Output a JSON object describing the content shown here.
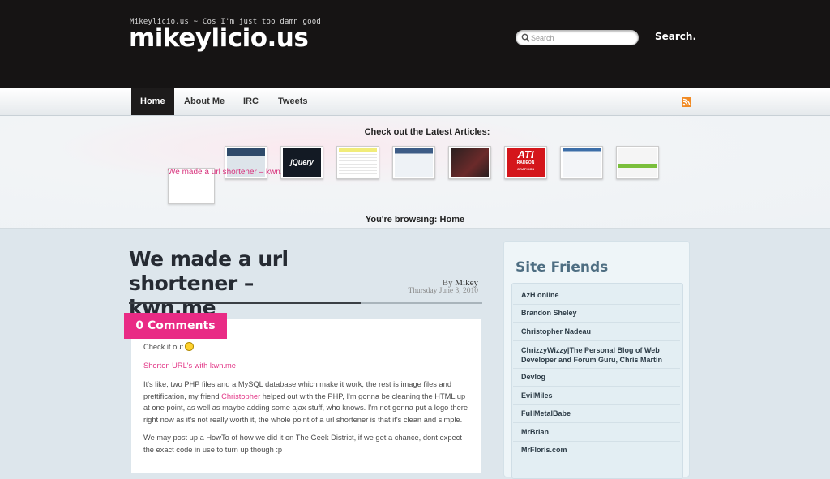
{
  "header": {
    "tagline": "Mikeylicio.us ~ Cos I'm just too damn good",
    "site_title": "mikeylicio.us",
    "search_placeholder": "Search",
    "search_button": "Search."
  },
  "nav": {
    "items": [
      {
        "label": "Home",
        "active": true
      },
      {
        "label": "About Me"
      },
      {
        "label": "IRC"
      },
      {
        "label": "Tweets"
      }
    ],
    "rss_icon": "rss-icon"
  },
  "featured": {
    "heading": "Check out the Latest Articles:",
    "active_caption": "We made a url shortener – kwn.me",
    "browsing": "You're browsing: Home",
    "thumbs": [
      {
        "name": "thumb-1",
        "colors": [
          "#2f4a6a",
          "#dde4ea"
        ]
      },
      {
        "name": "thumb-jquery",
        "text": "jQuery",
        "colors": [
          "#131a24",
          "#2b5f9e"
        ]
      },
      {
        "name": "thumb-3",
        "colors": [
          "#f1ec7a",
          "#ffffff"
        ]
      },
      {
        "name": "thumb-4",
        "colors": [
          "#3d5c86",
          "#eef2f6"
        ]
      },
      {
        "name": "thumb-5",
        "colors": [
          "#2a2020",
          "#6b2a2a"
        ]
      },
      {
        "name": "thumb-ati",
        "text": "ATI",
        "subtext": "RADEON",
        "small": "GRAPHICS",
        "colors": [
          "#d4161b",
          "#ffffff"
        ]
      },
      {
        "name": "thumb-7",
        "colors": [
          "#3c6ea8",
          "#f3f5f8"
        ]
      },
      {
        "name": "thumb-8",
        "colors": [
          "#7abf3c",
          "#f5f5f5"
        ]
      }
    ]
  },
  "post": {
    "title": "We made a url shortener – kwn.me",
    "author_prefix": "By",
    "author": "Mikey",
    "date": "Thursday June 3, 2010",
    "comments": "0 Comments",
    "p1": "Check it out",
    "link1": "Shorten URL's with kwn.me",
    "p2_a": "It's like, two PHP files and a MySQL database which make it work, the rest is image files and prettification, my friend ",
    "p2_link": "Christopher",
    "p2_b": " helped out with the PHP, I'm gonna be cleaning the HTML up at one point, as well as maybe adding some ajax stuff, who knows. I'm not gonna put a logo there right now as it's not really worth it, the whole point of a url shortener is that it's clean and simple.",
    "p3": "We may post up a HowTo of how we did it on The Geek District, if we get a chance, dont expect the exact code in use to turn up though :p"
  },
  "sidebar": {
    "title": "Site Friends",
    "friends": [
      "AzH online",
      "Brandon Sheley",
      "Christopher Nadeau",
      "ChrizzyWizzy|The Personal Blog of Web Developer and Forum Guru, Chris Martin",
      "Devlog",
      "EvilMiles",
      "FullMetalBabe",
      "MrBrian",
      "MrFloris.com"
    ]
  },
  "colors": {
    "accent": "#e92b85",
    "header_bg": "#161414",
    "sidebar_title": "#4e6e82"
  }
}
